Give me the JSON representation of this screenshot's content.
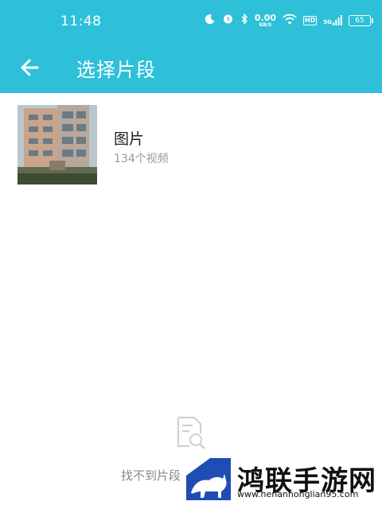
{
  "status_bar": {
    "time": "11:48",
    "net_speed_value": "0.00",
    "net_speed_unit": "KB/S",
    "hd_label": "HD",
    "signal_label": "5G",
    "battery": "65"
  },
  "toolbar": {
    "title": "选择片段"
  },
  "clips": [
    {
      "title": "图片",
      "subtitle": "134个视频"
    }
  ],
  "empty_state": {
    "text": "找不到片段"
  },
  "watermark": {
    "brand": "鸿联手游网",
    "url": "www.henanhonglian95.com"
  },
  "colors": {
    "primary": "#2ec0d9",
    "text_primary": "#222222",
    "text_secondary": "#999999"
  }
}
